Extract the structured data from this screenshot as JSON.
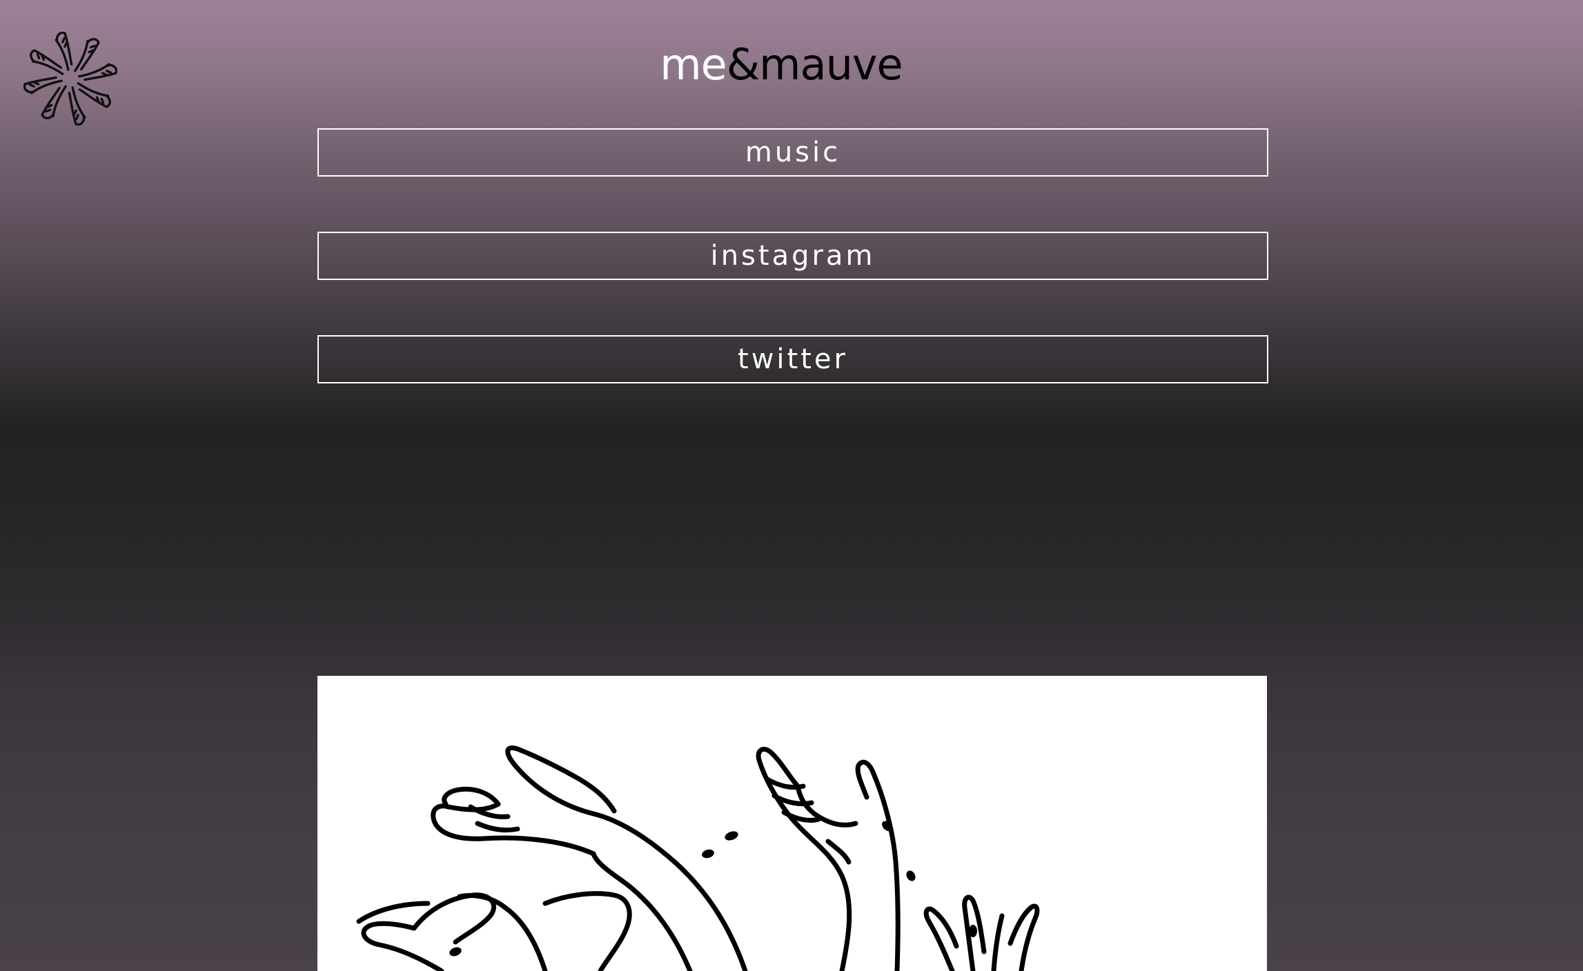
{
  "header": {
    "logo_icon": "hands-circle-logo-icon",
    "title_part1": "me",
    "title_part2": "&mauve",
    "title_part1_color": "#ffffff",
    "title_part2_color": "#000000"
  },
  "nav": {
    "items": [
      {
        "label": "music"
      },
      {
        "label": "instagram"
      },
      {
        "label": "twitter"
      }
    ]
  },
  "artwork": {
    "icon": "reaching-hands-illustration",
    "background": "#ffffff"
  },
  "theme": {
    "gradient_top": "#9d8399",
    "gradient_mid": "#222222",
    "gradient_bottom": "#4a414b",
    "button_border": "#ffffff"
  }
}
